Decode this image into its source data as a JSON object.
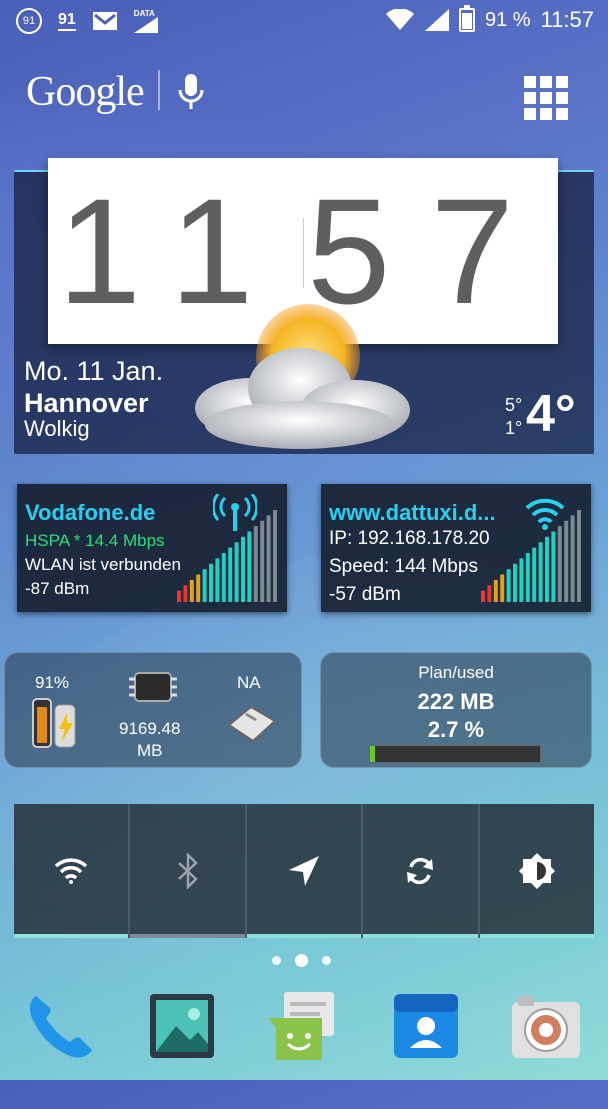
{
  "status_bar": {
    "left_icons": [
      "91",
      "91",
      "gmail-icon",
      "DATA"
    ],
    "battery": "91 %",
    "time": "11:57"
  },
  "google_bar": {
    "logo": "Google"
  },
  "clock_widget": {
    "hours": "11",
    "minutes": "57",
    "date": "Mo. 11 Jan.",
    "city": "Hannover",
    "condition": "Wolkig",
    "high": "5°",
    "low": "1°",
    "temperature": "4°"
  },
  "mobile_widget": {
    "operator": "Vodafone.de",
    "network": "HSPA * 14.4 Mbps",
    "wlan_status": "WLAN ist verbunden",
    "signal": "-87 dBm"
  },
  "wifi_widget": {
    "ssid": "www.dattuxi.d...",
    "ip": "IP: 192.168.178.20",
    "speed": "Speed: 144 Mbps",
    "signal": "-57 dBm"
  },
  "system_widget": {
    "battery": "91%",
    "memory_value": "9169.48",
    "memory_unit": "MB",
    "sd": "NA"
  },
  "data_widget": {
    "label": "Plan/used",
    "used": "222 MB",
    "percent": "2.7 %",
    "usage_fraction": 0.027
  },
  "quick_toggles": [
    {
      "name": "wifi-icon",
      "state": "on"
    },
    {
      "name": "bluetooth-icon",
      "state": "off"
    },
    {
      "name": "location-icon",
      "state": "on"
    },
    {
      "name": "sync-icon",
      "state": "on"
    },
    {
      "name": "brightness-icon",
      "state": "on"
    }
  ],
  "home_pages": {
    "count": 3,
    "active": 1
  },
  "dock_apps": [
    "phone-icon",
    "gallery-icon",
    "messages-icon",
    "contacts-icon",
    "camera-icon"
  ],
  "colors": {
    "accent_cyan": "#27d0ec",
    "network_green": "#29e07a",
    "toggle_on": "#8fe0d8"
  }
}
